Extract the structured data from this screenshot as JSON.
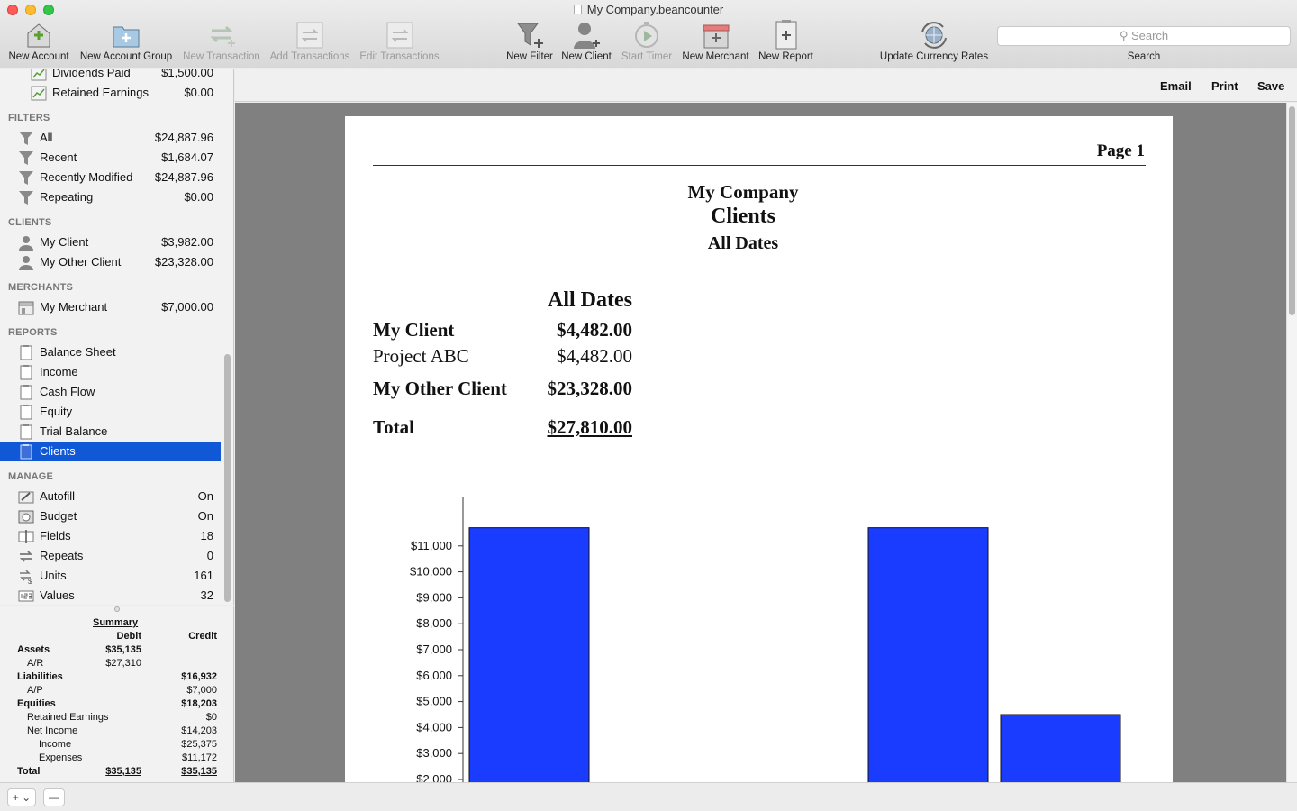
{
  "window": {
    "title": "My Company.beancounter"
  },
  "toolbar": {
    "items": [
      {
        "label": "New Account",
        "icon": "new-account-icon",
        "enabled": true
      },
      {
        "label": "New Account Group",
        "icon": "new-account-group-icon",
        "enabled": true
      },
      {
        "label": "New Transaction",
        "icon": "new-transaction-icon",
        "enabled": false
      },
      {
        "label": "Add Transactions",
        "icon": "add-transactions-icon",
        "enabled": false
      },
      {
        "label": "Edit Transactions",
        "icon": "edit-transactions-icon",
        "enabled": false
      },
      {
        "label": "New Filter",
        "icon": "new-filter-icon",
        "enabled": true
      },
      {
        "label": "New Client",
        "icon": "new-client-icon",
        "enabled": true
      },
      {
        "label": "Start Timer",
        "icon": "start-timer-icon",
        "enabled": false
      },
      {
        "label": "New Merchant",
        "icon": "new-merchant-icon",
        "enabled": true
      },
      {
        "label": "New Report",
        "icon": "new-report-icon",
        "enabled": true
      },
      {
        "label": "Update Currency Rates",
        "icon": "update-currency-rates-icon",
        "enabled": true
      }
    ],
    "search_placeholder": "Search",
    "search_label": "Search"
  },
  "sidebar": {
    "accounts": [
      {
        "label": "Dividends Paid",
        "value": "$1,500.00"
      },
      {
        "label": "Retained Earnings",
        "value": "$0.00"
      }
    ],
    "filters_title": "FILTERS",
    "filters": [
      {
        "label": "All",
        "value": "$24,887.96"
      },
      {
        "label": "Recent",
        "value": "$1,684.07"
      },
      {
        "label": "Recently Modified",
        "value": "$24,887.96"
      },
      {
        "label": "Repeating",
        "value": "$0.00"
      }
    ],
    "clients_title": "CLIENTS",
    "clients": [
      {
        "label": "My Client",
        "value": "$3,982.00"
      },
      {
        "label": "My Other Client",
        "value": "$23,328.00"
      }
    ],
    "merchants_title": "MERCHANTS",
    "merchants": [
      {
        "label": "My Merchant",
        "value": "$7,000.00"
      }
    ],
    "reports_title": "REPORTS",
    "reports": [
      {
        "label": "Balance Sheet"
      },
      {
        "label": "Income"
      },
      {
        "label": "Cash Flow"
      },
      {
        "label": "Equity"
      },
      {
        "label": "Trial Balance"
      },
      {
        "label": "Clients",
        "selected": true
      }
    ],
    "manage_title": "MANAGE",
    "manage": [
      {
        "label": "Autofill",
        "value": "On"
      },
      {
        "label": "Budget",
        "value": "On"
      },
      {
        "label": "Fields",
        "value": "18"
      },
      {
        "label": "Repeats",
        "value": "0"
      },
      {
        "label": "Units",
        "value": "161"
      },
      {
        "label": "Values",
        "value": "32"
      }
    ]
  },
  "summary": {
    "title": "Summary",
    "debit_header": "Debit",
    "credit_header": "Credit",
    "rows": [
      {
        "label": "Assets",
        "debit": "$35,135",
        "credit": "",
        "level": 0,
        "bold": true
      },
      {
        "label": "A/R",
        "debit": "$27,310",
        "credit": "",
        "level": 1,
        "bold": false
      },
      {
        "label": "Liabilities",
        "debit": "",
        "credit": "$16,932",
        "level": 0,
        "bold": true
      },
      {
        "label": "A/P",
        "debit": "",
        "credit": "$7,000",
        "level": 1,
        "bold": false
      },
      {
        "label": "Equities",
        "debit": "",
        "credit": "$18,203",
        "level": 0,
        "bold": true
      },
      {
        "label": "Retained Earnings",
        "debit": "",
        "credit": "$0",
        "level": 1,
        "bold": false
      },
      {
        "label": "Net Income",
        "debit": "",
        "credit": "$14,203",
        "level": 1,
        "bold": false
      },
      {
        "label": "Income",
        "debit": "",
        "credit": "$25,375",
        "level": 2,
        "bold": false
      },
      {
        "label": "Expenses",
        "debit": "",
        "credit": "$11,172",
        "level": 2,
        "bold": false
      },
      {
        "label": "Total",
        "debit": "$35,135",
        "credit": "$35,135",
        "level": 0,
        "bold": true,
        "underline": true
      }
    ]
  },
  "bottom": {
    "add_label": "+ ⌄",
    "remove_label": "—"
  },
  "actions": {
    "email": "Email",
    "print": "Print",
    "save": "Save"
  },
  "report": {
    "page_label": "Page 1",
    "company": "My Company",
    "title": "Clients",
    "subtitle": "All Dates",
    "column_header": "All Dates",
    "rows": [
      {
        "label": "My Client",
        "amount": "$4,482.00",
        "bold": true
      },
      {
        "label": "Project ABC",
        "amount": "$4,482.00",
        "bold": false
      },
      {
        "label": "My Other Client",
        "amount": "$23,328.00",
        "bold": true
      },
      {
        "label": "Total",
        "amount": "$27,810.00",
        "bold": true,
        "underline": true
      }
    ]
  },
  "chart_data": {
    "type": "bar",
    "categories": [
      "",
      "",
      ""
    ],
    "series": [
      {
        "values": [
          11700,
          11700,
          4500
        ],
        "color": "#1a3cff"
      }
    ],
    "yticks": [
      "$2,000",
      "$3,000",
      "$4,000",
      "$5,000",
      "$6,000",
      "$7,000",
      "$8,000",
      "$9,000",
      "$10,000",
      "$11,000"
    ],
    "ytick_values": [
      2000,
      3000,
      4000,
      5000,
      6000,
      7000,
      8000,
      9000,
      10000,
      11000
    ],
    "ylim": [
      2000,
      11700
    ],
    "grid": false
  }
}
